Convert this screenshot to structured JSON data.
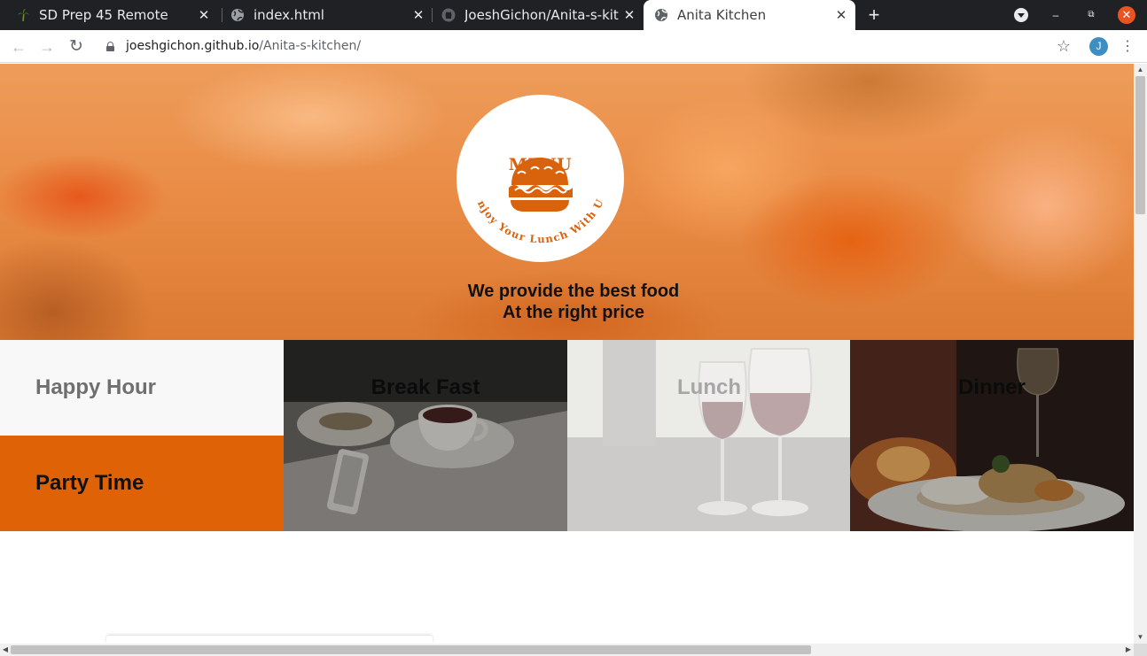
{
  "browser": {
    "tabs": [
      {
        "title": "SD Prep 45 Remote",
        "icon": "palm-tree-icon",
        "active": false
      },
      {
        "title": "index.html",
        "icon": "globe-icon",
        "active": false
      },
      {
        "title": "JoeshGichon/Anita-s-kitc",
        "icon": "github-icon",
        "active": false
      },
      {
        "title": "Anita Kitchen",
        "icon": "globe-icon",
        "active": true
      }
    ],
    "close_glyph": "✕",
    "new_tab_glyph": "+",
    "url_host": "joeshgichon.github.io",
    "url_path": "/Anita-s-kitchen/",
    "profile_initial": "J",
    "back_glyph": "←",
    "forward_glyph": "→",
    "reload_glyph": "↻",
    "star_glyph": "☆",
    "menu_glyph": "⋮",
    "minimize_glyph": "–",
    "restore_glyph": "⧉",
    "window_close_glyph": "✕"
  },
  "hero": {
    "logo_title": "MENU",
    "logo_arc_text": "Enjoy Your Lunch With Us",
    "tagline_line1": "We provide the best food",
    "tagline_line2": "At the right price"
  },
  "menu_grid": {
    "happy_hour": "Happy Hour",
    "party_time": "Party Time",
    "breakfast": "Break Fast",
    "lunch": "Lunch",
    "dinner": "Dinner"
  },
  "colors": {
    "accent_orange": "#e06206",
    "logo_orange": "#d9620c",
    "chrome_dark": "#202124"
  }
}
